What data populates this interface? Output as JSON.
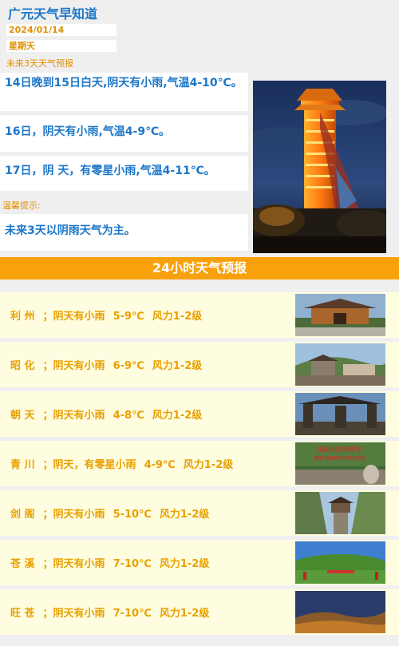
{
  "header": {
    "title": "广元天气早知道",
    "date": "2024/01/14",
    "weekday": "星期天",
    "subhead": "未来3天天气预报"
  },
  "forecast": [
    "14日晚到15日白天,阴天有小雨,气温4-10℃。",
    "16日，阴天有小雨,气温4-9℃。",
    "17日，阴  天，有零星小雨,气温4-11℃。"
  ],
  "tip": {
    "label": "温馨提示:",
    "text": "未来3天以阴雨天气为主。"
  },
  "banner": "24小时天气预报",
  "cities": [
    {
      "name": "利 州",
      "weather": "阴天有小雨",
      "temp": "5-9℃",
      "wind": "风力1-2级"
    },
    {
      "name": "昭 化",
      "weather": "阴天有小雨",
      "temp": "6-9℃",
      "wind": "风力1-2级"
    },
    {
      "name": "朝 天",
      "weather": "阴天有小雨",
      "temp": "4-8℃",
      "wind": "风力1-2级"
    },
    {
      "name": "青 川",
      "weather": "阴天，有零星小雨",
      "temp": "4-9℃",
      "wind": "风力1-2级"
    },
    {
      "name": "剑 阁",
      "weather": "阴天有小雨",
      "temp": "5-10℃",
      "wind": "风力1-2级"
    },
    {
      "name": "苍 溪",
      "weather": "阴天有小雨",
      "temp": "7-10℃",
      "wind": "风力1-2级"
    },
    {
      "name": "旺 苍",
      "weather": "阴天有小雨",
      "temp": "7-10℃",
      "wind": "风力1-2级"
    }
  ],
  "photo_signs": {
    "qingchuan_line1": "国家级自然保护区",
    "qingchuan_line2": "唐家河国家级自然保护区"
  }
}
